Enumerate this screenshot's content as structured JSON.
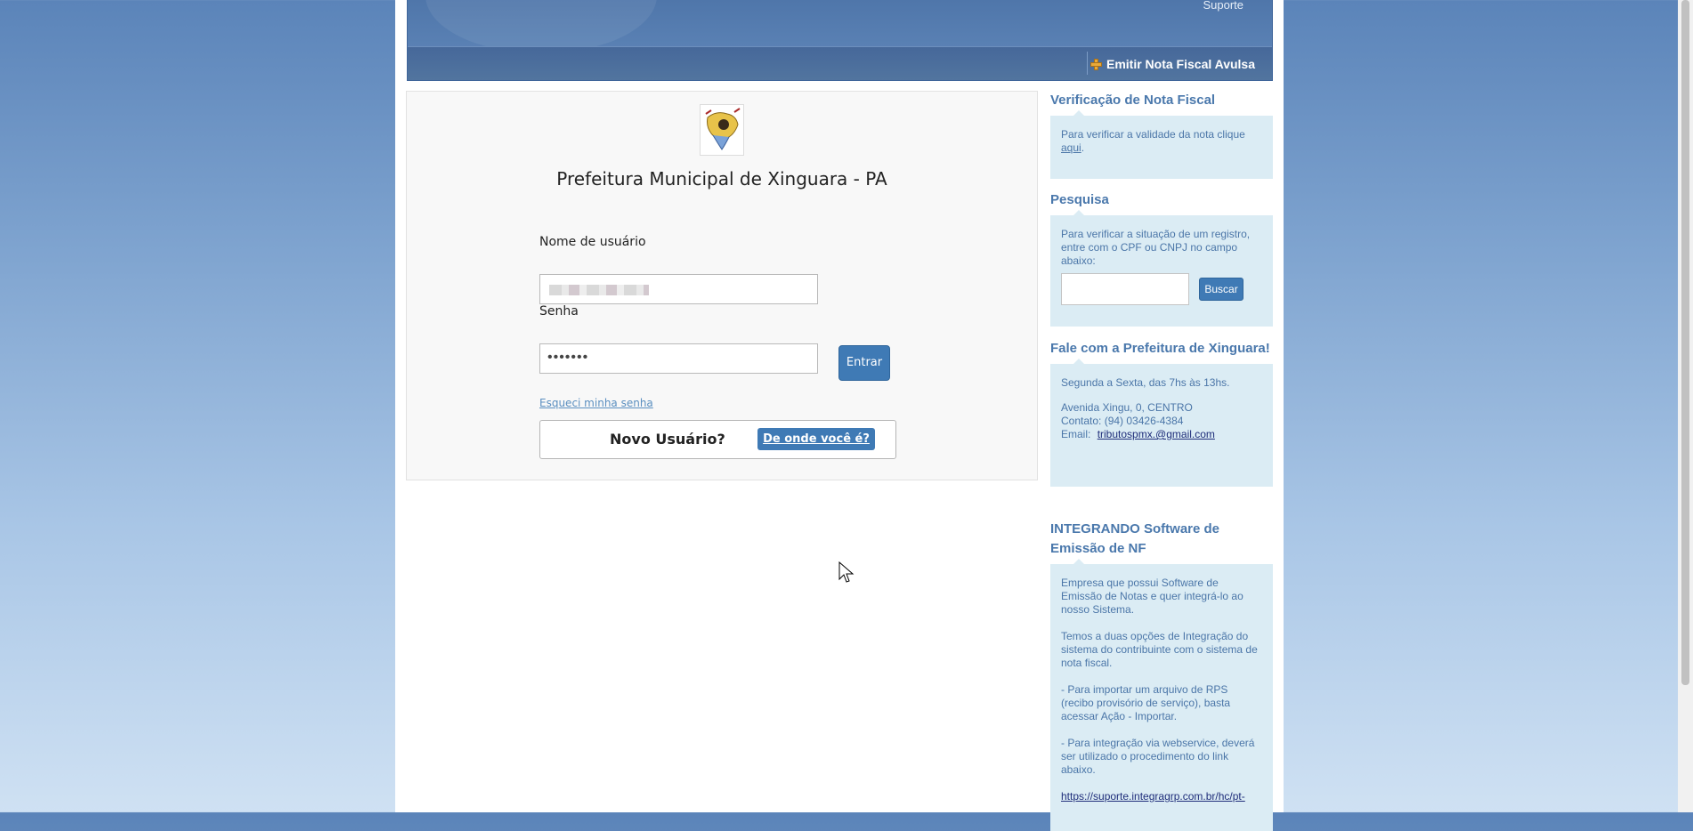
{
  "header": {
    "support_link": "Suporte",
    "emit_label": "Emitir Nota Fiscal Avulsa",
    "emit_icon": "plus-icon"
  },
  "login": {
    "org_title": "Prefeitura Municipal de Xinguara - PA",
    "username_label": "Nome de usuário",
    "password_label": "Senha",
    "password_value": "•••••••",
    "submit_label": "Entrar",
    "forgot_link": "Esqueci minha senha",
    "new_user_text": "Novo Usuário?",
    "where_button": "De onde você é?"
  },
  "sidebar": {
    "verify": {
      "title": "Verificação de Nota Fiscal",
      "text": "Para verificar a validade da nota clique",
      "link": "aqui",
      "suffix": "."
    },
    "search": {
      "title": "Pesquisa",
      "text": "Para verificar a situação de um registro, entre com o CPF ou CNPJ no campo abaixo:",
      "button": "Buscar"
    },
    "contact": {
      "title": "Fale com a Prefeitura de Xinguara!",
      "hours": "Segunda a Sexta, das 7hs às 13hs.",
      "address": "Avenida Xingu, 0, CENTRO",
      "phone": "Contato: (94) 03426-4384",
      "email_label": "Email:",
      "email": "tributospmx.@gmail.com"
    },
    "integration": {
      "title": "INTEGRANDO Software de Emissão de NF",
      "p1": "Empresa que possui Software de Emissão de Notas e quer integrá-lo ao nosso Sistema.",
      "p2": "Temos a duas opções de Integração do sistema do contribuinte com o sistema de nota fiscal.",
      "p3": "- Para importar um arquivo de RPS (recibo provisório de serviço), basta acessar Ação - Importar.",
      "p4": "- Para integração via webservice, deverá ser utilizado o procedimento do link abaixo.",
      "link": "https://suporte.integragrp.com.br/hc/pt-"
    }
  }
}
